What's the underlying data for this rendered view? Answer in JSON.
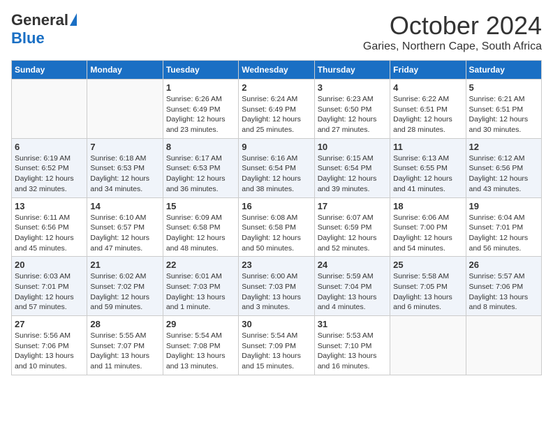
{
  "header": {
    "logo_general": "General",
    "logo_blue": "Blue",
    "month": "October 2024",
    "location": "Garies, Northern Cape, South Africa"
  },
  "weekdays": [
    "Sunday",
    "Monday",
    "Tuesday",
    "Wednesday",
    "Thursday",
    "Friday",
    "Saturday"
  ],
  "weeks": [
    [
      {
        "day": "",
        "info": ""
      },
      {
        "day": "",
        "info": ""
      },
      {
        "day": "1",
        "info": "Sunrise: 6:26 AM\nSunset: 6:49 PM\nDaylight: 12 hours and 23 minutes."
      },
      {
        "day": "2",
        "info": "Sunrise: 6:24 AM\nSunset: 6:49 PM\nDaylight: 12 hours and 25 minutes."
      },
      {
        "day": "3",
        "info": "Sunrise: 6:23 AM\nSunset: 6:50 PM\nDaylight: 12 hours and 27 minutes."
      },
      {
        "day": "4",
        "info": "Sunrise: 6:22 AM\nSunset: 6:51 PM\nDaylight: 12 hours and 28 minutes."
      },
      {
        "day": "5",
        "info": "Sunrise: 6:21 AM\nSunset: 6:51 PM\nDaylight: 12 hours and 30 minutes."
      }
    ],
    [
      {
        "day": "6",
        "info": "Sunrise: 6:19 AM\nSunset: 6:52 PM\nDaylight: 12 hours and 32 minutes."
      },
      {
        "day": "7",
        "info": "Sunrise: 6:18 AM\nSunset: 6:53 PM\nDaylight: 12 hours and 34 minutes."
      },
      {
        "day": "8",
        "info": "Sunrise: 6:17 AM\nSunset: 6:53 PM\nDaylight: 12 hours and 36 minutes."
      },
      {
        "day": "9",
        "info": "Sunrise: 6:16 AM\nSunset: 6:54 PM\nDaylight: 12 hours and 38 minutes."
      },
      {
        "day": "10",
        "info": "Sunrise: 6:15 AM\nSunset: 6:54 PM\nDaylight: 12 hours and 39 minutes."
      },
      {
        "day": "11",
        "info": "Sunrise: 6:13 AM\nSunset: 6:55 PM\nDaylight: 12 hours and 41 minutes."
      },
      {
        "day": "12",
        "info": "Sunrise: 6:12 AM\nSunset: 6:56 PM\nDaylight: 12 hours and 43 minutes."
      }
    ],
    [
      {
        "day": "13",
        "info": "Sunrise: 6:11 AM\nSunset: 6:56 PM\nDaylight: 12 hours and 45 minutes."
      },
      {
        "day": "14",
        "info": "Sunrise: 6:10 AM\nSunset: 6:57 PM\nDaylight: 12 hours and 47 minutes."
      },
      {
        "day": "15",
        "info": "Sunrise: 6:09 AM\nSunset: 6:58 PM\nDaylight: 12 hours and 48 minutes."
      },
      {
        "day": "16",
        "info": "Sunrise: 6:08 AM\nSunset: 6:58 PM\nDaylight: 12 hours and 50 minutes."
      },
      {
        "day": "17",
        "info": "Sunrise: 6:07 AM\nSunset: 6:59 PM\nDaylight: 12 hours and 52 minutes."
      },
      {
        "day": "18",
        "info": "Sunrise: 6:06 AM\nSunset: 7:00 PM\nDaylight: 12 hours and 54 minutes."
      },
      {
        "day": "19",
        "info": "Sunrise: 6:04 AM\nSunset: 7:01 PM\nDaylight: 12 hours and 56 minutes."
      }
    ],
    [
      {
        "day": "20",
        "info": "Sunrise: 6:03 AM\nSunset: 7:01 PM\nDaylight: 12 hours and 57 minutes."
      },
      {
        "day": "21",
        "info": "Sunrise: 6:02 AM\nSunset: 7:02 PM\nDaylight: 12 hours and 59 minutes."
      },
      {
        "day": "22",
        "info": "Sunrise: 6:01 AM\nSunset: 7:03 PM\nDaylight: 13 hours and 1 minute."
      },
      {
        "day": "23",
        "info": "Sunrise: 6:00 AM\nSunset: 7:03 PM\nDaylight: 13 hours and 3 minutes."
      },
      {
        "day": "24",
        "info": "Sunrise: 5:59 AM\nSunset: 7:04 PM\nDaylight: 13 hours and 4 minutes."
      },
      {
        "day": "25",
        "info": "Sunrise: 5:58 AM\nSunset: 7:05 PM\nDaylight: 13 hours and 6 minutes."
      },
      {
        "day": "26",
        "info": "Sunrise: 5:57 AM\nSunset: 7:06 PM\nDaylight: 13 hours and 8 minutes."
      }
    ],
    [
      {
        "day": "27",
        "info": "Sunrise: 5:56 AM\nSunset: 7:06 PM\nDaylight: 13 hours and 10 minutes."
      },
      {
        "day": "28",
        "info": "Sunrise: 5:55 AM\nSunset: 7:07 PM\nDaylight: 13 hours and 11 minutes."
      },
      {
        "day": "29",
        "info": "Sunrise: 5:54 AM\nSunset: 7:08 PM\nDaylight: 13 hours and 13 minutes."
      },
      {
        "day": "30",
        "info": "Sunrise: 5:54 AM\nSunset: 7:09 PM\nDaylight: 13 hours and 15 minutes."
      },
      {
        "day": "31",
        "info": "Sunrise: 5:53 AM\nSunset: 7:10 PM\nDaylight: 13 hours and 16 minutes."
      },
      {
        "day": "",
        "info": ""
      },
      {
        "day": "",
        "info": ""
      }
    ]
  ]
}
